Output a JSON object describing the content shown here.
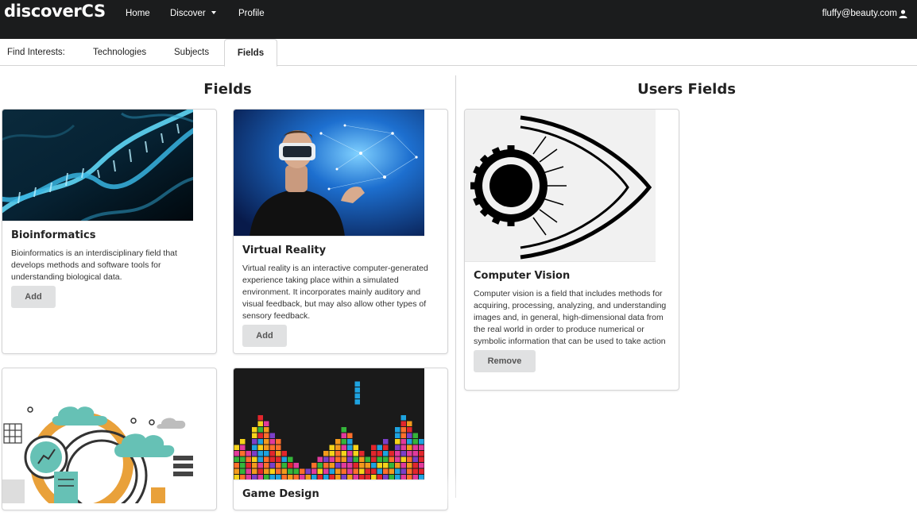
{
  "navbar": {
    "brand": "discoverCS",
    "links": [
      {
        "label": "Home"
      },
      {
        "label": "Discover"
      },
      {
        "label": "Profile"
      }
    ],
    "user_email": "fluffy@beauty.com"
  },
  "tabs": {
    "prefix": "Find Interests:",
    "items": [
      {
        "label": "Technologies"
      },
      {
        "label": "Subjects"
      },
      {
        "label": "Fields",
        "active": true
      }
    ]
  },
  "fields_section": {
    "title": "Fields",
    "cards": [
      {
        "title": "Bioinformatics",
        "description": "Bioinformatics is an interdisciplinary field that develops methods and software tools for understanding biological data.",
        "button": "Add"
      },
      {
        "title": "Virtual Reality",
        "description": "Virtual reality is an interactive computer-generated experience taking place within a simulated environment. It incorporates mainly auditory and visual feedback, but may also allow other types of sensory feedback.",
        "button": "Add"
      },
      {
        "title": "",
        "description": "",
        "button": ""
      },
      {
        "title": "Game Design",
        "description": "",
        "button": ""
      }
    ]
  },
  "user_fields_section": {
    "title": "Users Fields",
    "cards": [
      {
        "title": "Computer Vision",
        "description": "Computer vision is a field that includes methods for acquiring, processing, analyzing, and understanding images and, in general, high-dimensional data from the real world in order to produce numerical or symbolic information that can be used to take action",
        "button": "Remove"
      }
    ]
  },
  "colors": {
    "navbar_bg": "#1b1c1d",
    "button_bg": "#e0e1e2",
    "border": "#d4d4d5"
  }
}
